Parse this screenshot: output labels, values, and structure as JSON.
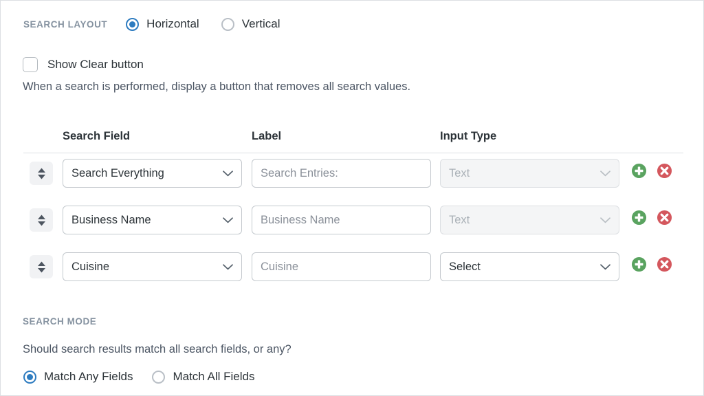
{
  "search_layout": {
    "section_label": "SEARCH LAYOUT",
    "options": [
      {
        "label": "Horizontal",
        "selected": true
      },
      {
        "label": "Vertical",
        "selected": false
      }
    ]
  },
  "clear_button": {
    "label": "Show Clear button",
    "checked": false,
    "description": "When a search is performed, display a button that removes all search values."
  },
  "fields_table": {
    "columns": {
      "search_field": "Search Field",
      "label": "Label",
      "input_type": "Input Type"
    },
    "rows": [
      {
        "search_field": "Search Everything",
        "label_value": "Search Entries:",
        "label_is_placeholder": true,
        "input_type": "Text",
        "input_type_disabled": true
      },
      {
        "search_field": "Business Name",
        "label_value": "Business Name",
        "label_is_placeholder": true,
        "input_type": "Text",
        "input_type_disabled": true
      },
      {
        "search_field": "Cuisine",
        "label_value": "Cuisine",
        "label_is_placeholder": true,
        "input_type": "Select",
        "input_type_disabled": false
      }
    ],
    "actions": {
      "add": "add-row",
      "remove": "remove-row",
      "drag": "reorder-row"
    }
  },
  "search_mode": {
    "section_label": "SEARCH MODE",
    "description": "Should search results match all search fields, or any?",
    "options": [
      {
        "label": "Match Any Fields",
        "selected": true
      },
      {
        "label": "Match All Fields",
        "selected": false
      }
    ]
  },
  "colors": {
    "accent_blue": "#2e7cc0",
    "add_green": "#5aa360",
    "remove_red": "#d4575d",
    "section_label_grey": "#8592a0",
    "body_text_grey": "#4b5563",
    "border_grey": "#c3c8cd"
  }
}
